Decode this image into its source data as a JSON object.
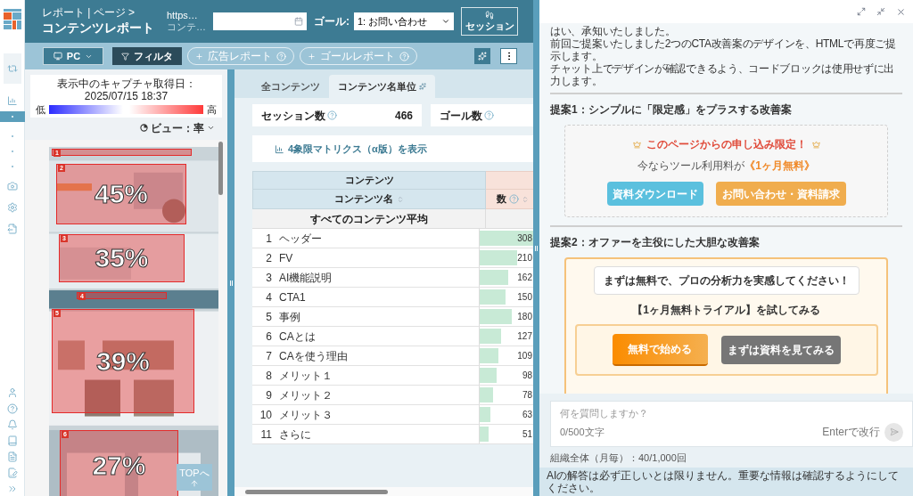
{
  "header": {
    "breadcrumb": "レポート | ページ >",
    "title": "コンテンツレポート",
    "url": "https…",
    "url_sub": "コンテ…",
    "goal_label": "ゴール:",
    "goal_value": "1: お問い合わせ",
    "session_button": "セッション"
  },
  "toolbar": {
    "device": "PC",
    "filter": "フィルタ",
    "pills": [
      "広告レポート",
      "ゴールレポート"
    ]
  },
  "heatmap": {
    "legend_title": "表示中のキャプチャ取得日：2025/07/15 18:37",
    "low": "低",
    "high": "高",
    "view": "ビュー：率",
    "top_button": "TOPへ",
    "sections": [
      {
        "number": "1"
      },
      {
        "number": "2",
        "percent": "45%"
      },
      {
        "number": "3",
        "percent": "35%"
      },
      {
        "number": "4"
      },
      {
        "number": "5",
        "percent": "39%"
      },
      {
        "number": "6",
        "percent": "27%"
      }
    ]
  },
  "tabs": [
    {
      "label": "全コンテンツ",
      "selected": false
    },
    {
      "label": "コンテンツ名単位",
      "selected": true
    }
  ],
  "metrics": [
    {
      "label": "セッション数",
      "value": "466"
    },
    {
      "label": "ゴール数"
    }
  ],
  "matrix_link": "4象限マトリクス（α版）を表示",
  "table": {
    "group_header": "コンテンツ",
    "name_column": "コンテンツ名",
    "value_column": "数",
    "average_label": "すべてのコンテンツ平均",
    "rows": [
      {
        "index": "1",
        "name": "ヘッダー",
        "value": "308",
        "level": 1
      },
      {
        "index": "2",
        "name": "FV",
        "value": "210",
        "level": 0.69
      },
      {
        "index": "3",
        "name": "AI機能説明",
        "value": "162",
        "level": 0.52
      },
      {
        "index": "4",
        "name": "CTA1",
        "value": "150",
        "level": 0.48
      },
      {
        "index": "5",
        "name": "事例",
        "value": "180",
        "level": 0.59
      },
      {
        "index": "6",
        "name": "CAとは",
        "value": "127",
        "level": 0.4
      },
      {
        "index": "7",
        "name": "CAを使う理由",
        "value": "109",
        "level": 0.34
      },
      {
        "index": "8",
        "name": "メリット１",
        "value": "98",
        "level": 0.31
      },
      {
        "index": "9",
        "name": "メリット２",
        "value": "78",
        "level": 0.24
      },
      {
        "index": "10",
        "name": "メリット３",
        "value": "63",
        "level": 0.19
      },
      {
        "index": "11",
        "name": "さらに",
        "value": "51",
        "level": 0.16
      }
    ]
  },
  "chat": {
    "message": [
      "はい、承知いたしました。",
      "前回ご提案いたしました2つのCTA改善案のデザインを、HTMLで再度ご提示します。",
      "チャット上でデザインが確認できるよう、コードブロックは使用せずに出力します。"
    ],
    "proposal1": {
      "heading": "提案1：シンプルに「限定感」をプラスする改善案",
      "banner": "このページからの申し込み限定！",
      "offer": "今ならツール利用料が**《1ヶ月無料》**",
      "buttons": [
        "資料ダウンロード",
        "お問い合わせ・資料請求"
      ]
    },
    "proposal2": {
      "heading": "提案2：オファーを主役にした大胆な改善案",
      "bubble": "まずは無料で、プロの分析力を実感してください！",
      "subtitle": "【1ヶ月無料トライアル】を試してみる",
      "primary_button": "無料で始める",
      "secondary_button": "まずは資料を見てみる"
    },
    "input_placeholder": "何を質問しますか？",
    "counter": "0/500文字",
    "enter_hint": "Enterで改行",
    "usage": "組織全体（月毎）：40/1,000回",
    "disclaimer": "AIの解答は必ず正しいとは限りません。重要な情報は確認するようにしてください。"
  }
}
